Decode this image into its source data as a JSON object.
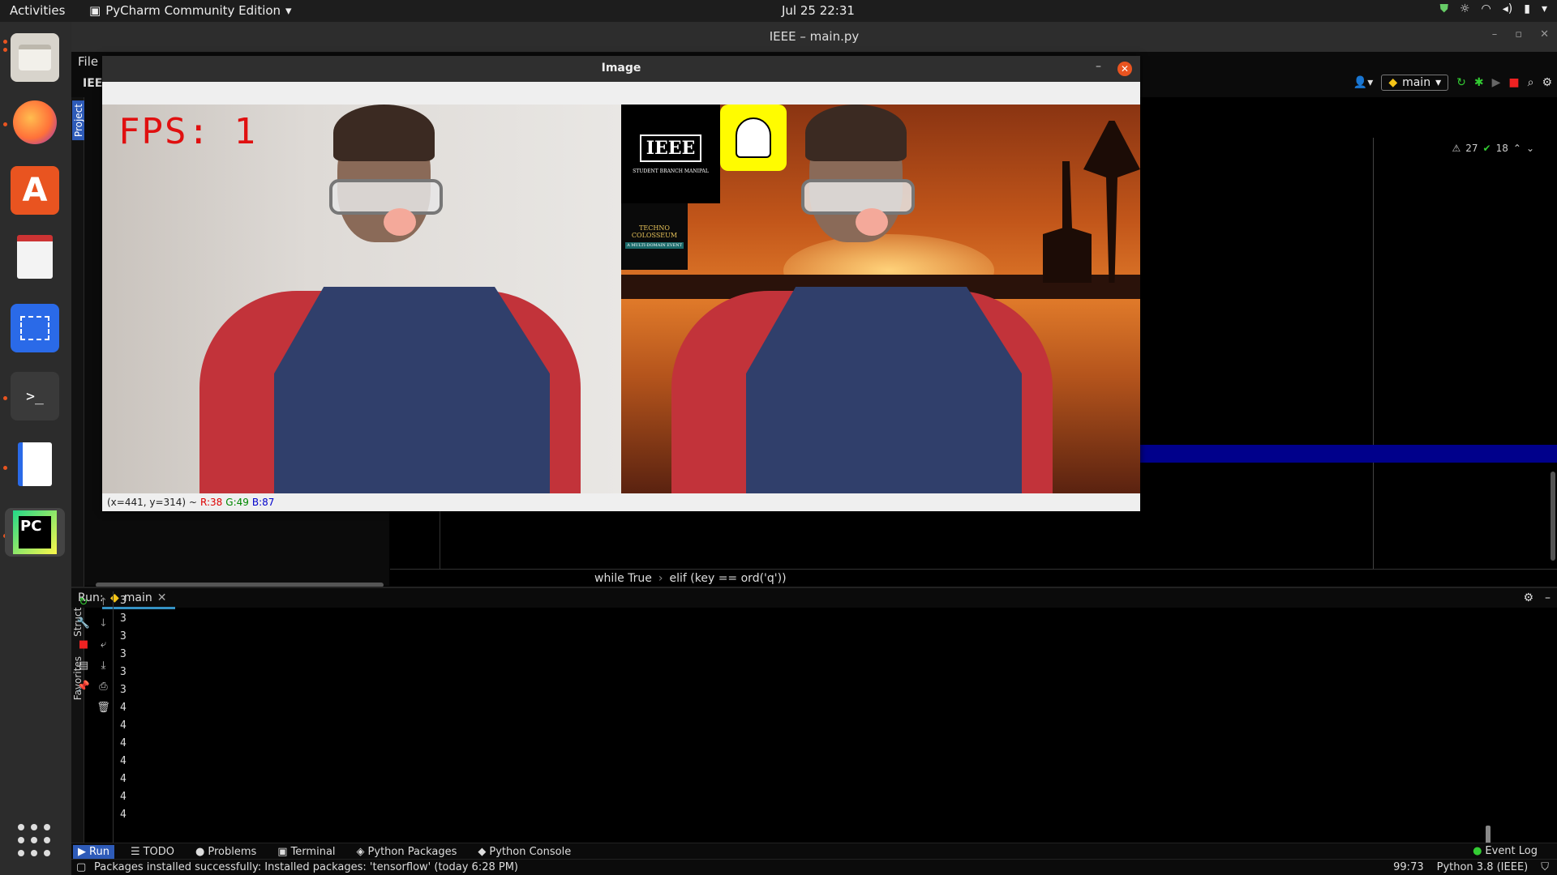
{
  "topbar": {
    "activities": "Activities",
    "app_name": "PyCharm Community Edition",
    "clock": "Jul 25  22:31"
  },
  "window": {
    "title": "IEEE – main.py",
    "menu_file": "File",
    "project_name": "IEE",
    "run_config": "main",
    "project_tab": "Project",
    "structure_tab": "Structure",
    "favorites_tab": "Favorites"
  },
  "editor": {
    "warnings": "27",
    "weak_warnings": "18",
    "breadcrumbs": [
      "while True",
      "elif (key == ord('q'))"
    ]
  },
  "run": {
    "label": "Run:",
    "tab": "main",
    "output": [
      "3",
      "3",
      "3",
      "3",
      "3",
      "3",
      "4",
      "4",
      "4",
      "4",
      "4",
      "4",
      "4"
    ]
  },
  "bottom_tabs": [
    "Run",
    "TODO",
    "Problems",
    "Terminal",
    "Python Packages",
    "Python Console"
  ],
  "event_log": "Event Log",
  "status": {
    "message": "Packages installed successfully: Installed packages: 'tensorflow' (today 6:28 PM)",
    "position": "99:73",
    "interpreter": "Python 3.8 (IEEE)"
  },
  "image_window": {
    "title": "Image",
    "fps_text": "FPS:  1",
    "coords": "(x=441, y=314) ~",
    "r": "R:38",
    "g": "G:49",
    "b": "B:87",
    "logos": {
      "ieee": "IEEE",
      "ieee_sub": "STUDENT BRANCH MANIPAL",
      "techno": "TECHNO COLOSSEUM",
      "techno_sub": "A MULTI-DOMAIN EVENT"
    }
  },
  "colors": {
    "accent_orange": "#e95420",
    "selection_blue": "#2e5bb8",
    "fps_red": "#e01010",
    "highlight_line": "#00008b"
  }
}
